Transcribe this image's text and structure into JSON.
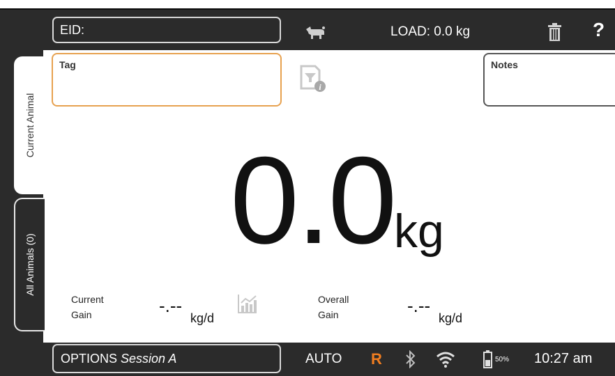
{
  "header": {
    "eid_label": "EID:",
    "load_text": "LOAD: 0.0 kg",
    "help_symbol": "?",
    "icons": [
      "scale-animal-icon",
      "trash-icon",
      "help-icon"
    ]
  },
  "tabs": [
    {
      "label": "Current Animal",
      "active": true
    },
    {
      "label": "All Animals (0)",
      "active": false
    }
  ],
  "fields": {
    "tag_label": "Tag",
    "notes_label": "Notes"
  },
  "weight": {
    "value": "0.0",
    "unit": "kg"
  },
  "gains": {
    "current": {
      "label_line1": "Current",
      "label_line2": "Gain",
      "value": "-.--",
      "unit": "kg/d"
    },
    "overall": {
      "label_line1": "Overall",
      "label_line2": "Gain",
      "value": "-.--",
      "unit": "kg/d"
    }
  },
  "footer": {
    "options_label": "OPTIONS",
    "session_name": "Session A",
    "mode": "AUTO",
    "indicator": "R",
    "battery": "50%",
    "time": "10:27 am",
    "icons": [
      "bluetooth-icon",
      "wifi-icon",
      "battery-icon"
    ]
  },
  "colors": {
    "bar": "#2b2b2b",
    "tag_border": "#e7a14f",
    "indicator": "#f07d20"
  }
}
